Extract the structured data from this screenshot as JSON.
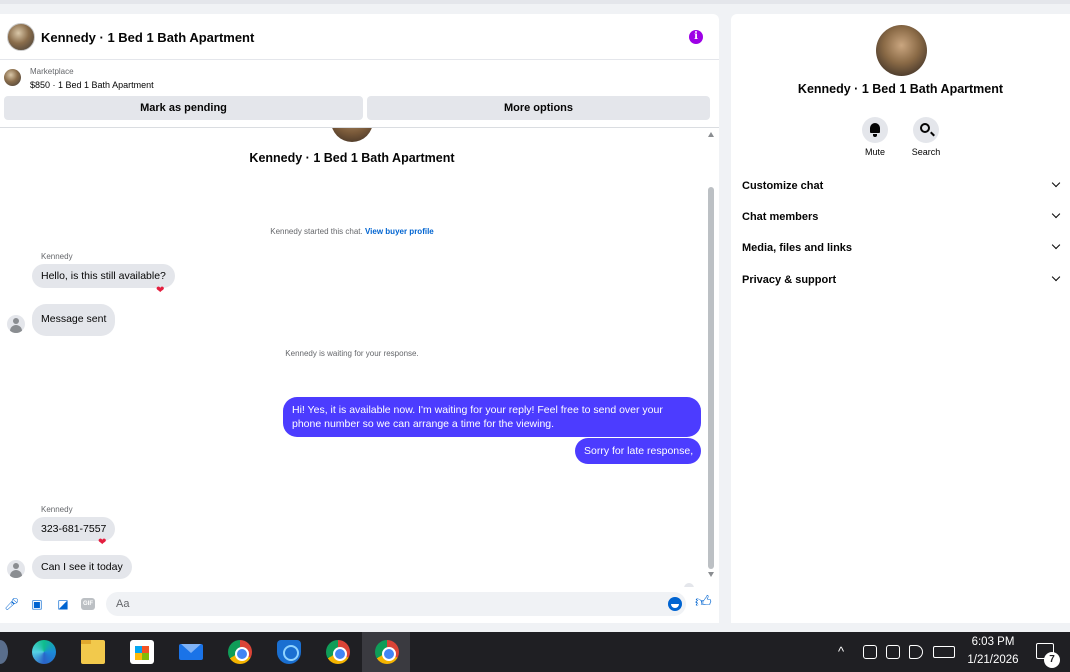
{
  "header": {
    "title": "Kennedy · 1 Bed 1 Bath Apartment",
    "info_icon": "info-icon"
  },
  "marketplace": {
    "label": "Marketplace",
    "price_line": "$850 · 1 Bed 1 Bath Apartment",
    "mark_pending": "Mark as pending",
    "more_options": "More options"
  },
  "conversation": {
    "listing_title": "Kennedy · 1 Bed 1 Bath Apartment",
    "started_text": "Kennedy started this chat.",
    "buyer_profile_link": "View buyer profile",
    "waiting_text": "Kennedy is waiting for your response.",
    "messages": [
      {
        "sender": "Kennedy",
        "text": "Hello, is this still available?",
        "reaction": "❤"
      },
      {
        "text": "Message sent"
      },
      {
        "text": "Hi! Yes, it is available now. I'm waiting for your reply! Feel free to send over your phone number so we can arrange a time for the viewing."
      },
      {
        "text": "Sorry for late response,"
      },
      {
        "sender": "Kennedy",
        "text": "323-681-7557",
        "reaction": "❤"
      },
      {
        "text": "Can I see it today"
      }
    ]
  },
  "composer": {
    "placeholder": "Aa",
    "gif_label": "GIF"
  },
  "right_panel": {
    "title": "Kennedy · 1 Bed 1 Bath Apartment",
    "mute_label": "Mute",
    "search_label": "Search",
    "sections": [
      "Customize chat",
      "Chat members",
      "Media, files and links",
      "Privacy & support"
    ]
  },
  "taskbar": {
    "time": "6:03 PM",
    "date": "1/21/2026",
    "notification_count": "7",
    "tray_up": "^"
  },
  "colors": {
    "outgoing_bubble": "#4c3cff",
    "incoming_bubble": "#e4e6eb",
    "accent": "#0064d1",
    "info_icon": "#9d00e6"
  }
}
